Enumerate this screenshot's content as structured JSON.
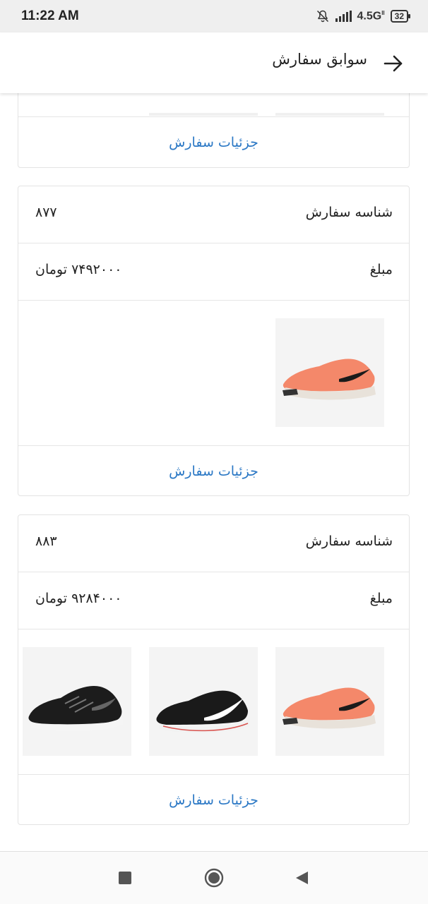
{
  "status_bar": {
    "time": "11:22 AM",
    "network": "4.5G",
    "network_sup": "II",
    "battery": "32",
    "icons": [
      "bell-off-icon",
      "signal-icon",
      "battery-icon"
    ]
  },
  "app_bar": {
    "title": "سوابق سفارش",
    "back_icon": "arrow-right-icon"
  },
  "orders": [
    {
      "details_label": "جزئیات سفارش",
      "products": [
        {
          "name": "product-thumb",
          "color": "#f4f4f4"
        },
        {
          "name": "product-thumb",
          "color": "#f4f4f4"
        }
      ]
    },
    {
      "id_label": "شناسه سفارش",
      "id_value": "۸۷۷",
      "amount_label": "مبلغ",
      "amount_value": "۷۴۹۲۰۰۰ تومان",
      "details_label": "جزئیات سفارش",
      "products": [
        {
          "name": "orange-running-shoe",
          "color": "#f4886a"
        }
      ]
    },
    {
      "id_label": "شناسه سفارش",
      "id_value": "۸۸۳",
      "amount_label": "مبلغ",
      "amount_value": "۹۲۸۴۰۰۰ تومان",
      "details_label": "جزئیات سفارش",
      "products": [
        {
          "name": "orange-running-shoe",
          "color": "#f4886a"
        },
        {
          "name": "black-white-running-shoe",
          "color": "#1a1a1a"
        },
        {
          "name": "black-trail-shoe",
          "color": "#1a1a1a"
        }
      ]
    }
  ],
  "nav_bar": {
    "icons": [
      "recents-square-icon",
      "home-circle-icon",
      "back-triangle-icon"
    ]
  },
  "colors": {
    "link": "#2b78c5",
    "status_bar_bg": "#efefef",
    "thumb_bg": "#f4f4f4"
  }
}
